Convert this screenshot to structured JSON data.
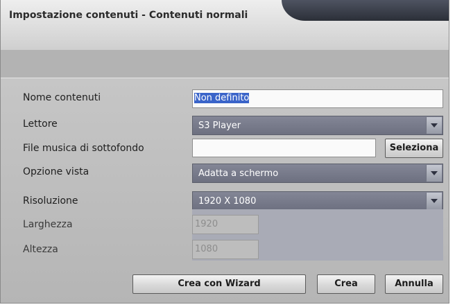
{
  "dialog": {
    "title": "Impostazione contenuti  - Contenuti normali"
  },
  "form": {
    "nome_contenuti": {
      "label": "Nome contenuti",
      "value": "Non definito"
    },
    "lettore": {
      "label": "Lettore",
      "value": "S3 Player"
    },
    "file_musica": {
      "label": "File musica di sottofondo",
      "value": "",
      "button": "Seleziona"
    },
    "opzione_vista": {
      "label": "Opzione vista",
      "value": "Adatta a schermo"
    },
    "risoluzione": {
      "label": "Risoluzione",
      "value": "1920 X 1080"
    },
    "larghezza": {
      "label": "Larghezza",
      "value": "1920"
    },
    "altezza": {
      "label": "Altezza",
      "value": "1080"
    }
  },
  "buttons": {
    "wizard": "Crea con Wizard",
    "crea": "Crea",
    "annulla": "Annulla"
  },
  "icons": {
    "dropdown": "chevron-down-icon"
  },
  "colors": {
    "select_bg": "#7b7e8e",
    "selection_highlight": "#3a64c9",
    "dialog_bg": "#b3b3b3"
  }
}
